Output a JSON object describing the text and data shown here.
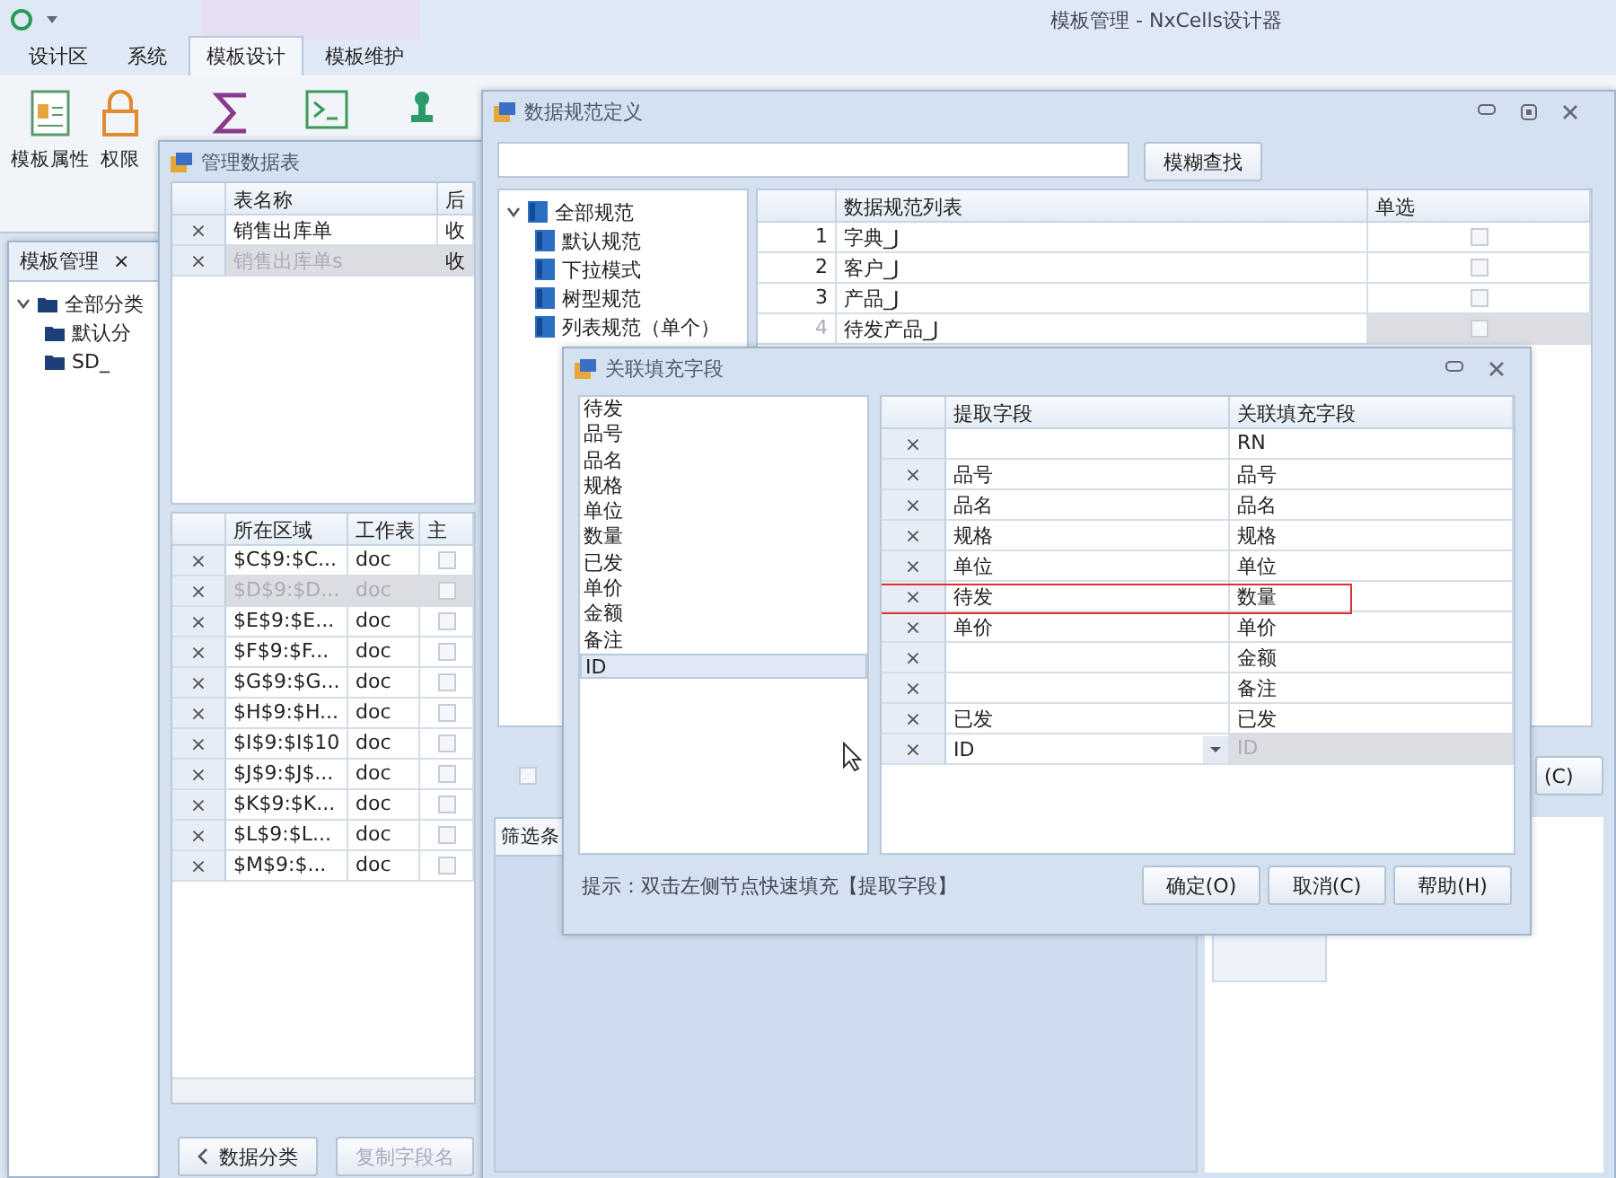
{
  "app": {
    "title": "模板管理 - NxCells设计器",
    "tabs": [
      {
        "label": "设计区",
        "selected": false
      },
      {
        "label": "系统",
        "selected": false
      },
      {
        "label": "模板设计",
        "selected": true
      },
      {
        "label": "模板维护",
        "selected": false
      }
    ],
    "ribbon": [
      "模板属性",
      "权限"
    ]
  },
  "side_panel": {
    "tab": "模板管理",
    "close": "×",
    "tree": [
      {
        "label": "全部分类",
        "expanded": true,
        "children": [
          {
            "label": "默认分"
          },
          {
            "label": "SD_"
          }
        ]
      }
    ]
  },
  "table_window": {
    "title": "管理数据表",
    "top_grid": {
      "columns": [
        "表名称",
        "后"
      ],
      "rows": [
        {
          "delete": "×",
          "cells": [
            "销售出库单",
            "收"
          ],
          "selected": false
        },
        {
          "delete": "×",
          "cells": [
            "销售出库单s",
            "收"
          ],
          "selected": true
        }
      ]
    },
    "bottom_grid": {
      "columns": [
        "所在区域",
        "工作表",
        "主"
      ],
      "rows": [
        {
          "delete": "×",
          "cells": [
            "$C$9:$C...",
            "doc"
          ],
          "selected": false,
          "checked": false
        },
        {
          "delete": "×",
          "cells": [
            "$D$9:$D...",
            "doc"
          ],
          "selected": true,
          "checked": false
        },
        {
          "delete": "×",
          "cells": [
            "$E$9:$E...",
            "doc"
          ],
          "selected": false,
          "checked": false
        },
        {
          "delete": "×",
          "cells": [
            "$F$9:$F...",
            "doc"
          ],
          "selected": false,
          "checked": false
        },
        {
          "delete": "×",
          "cells": [
            "$G$9:$G...",
            "doc"
          ],
          "selected": false,
          "checked": false
        },
        {
          "delete": "×",
          "cells": [
            "$H$9:$H...",
            "doc"
          ],
          "selected": false,
          "checked": false
        },
        {
          "delete": "×",
          "cells": [
            "$I$9:$I$10",
            "doc"
          ],
          "selected": false,
          "checked": false
        },
        {
          "delete": "×",
          "cells": [
            "$J$9:$J$...",
            "doc"
          ],
          "selected": false,
          "checked": false
        },
        {
          "delete": "×",
          "cells": [
            "$K$9:$K...",
            "doc"
          ],
          "selected": false,
          "checked": false
        },
        {
          "delete": "×",
          "cells": [
            "$L$9:$L...",
            "doc"
          ],
          "selected": false,
          "checked": false
        },
        {
          "delete": "×",
          "cells": [
            "$M$9:$...",
            "doc"
          ],
          "selected": false,
          "checked": false
        }
      ]
    },
    "buttons": [
      {
        "label": "数据分类",
        "disabled": false
      },
      {
        "label": "复制字段名",
        "disabled": true
      }
    ]
  },
  "spec_window": {
    "title": "数据规范定义",
    "search_button": "模糊查找",
    "tree": [
      {
        "label": "全部规范",
        "expanded": true,
        "children": [
          {
            "label": "默认规范"
          },
          {
            "label": "下拉模式"
          },
          {
            "label": "树型规范"
          },
          {
            "label": "列表规范（单个）"
          }
        ]
      }
    ],
    "grid": {
      "columns": [
        "数据规范列表",
        "单选"
      ],
      "rows": [
        {
          "index": "1",
          "name": "字典_J",
          "checked": false,
          "selected": false
        },
        {
          "index": "2",
          "name": "客户_J",
          "checked": false,
          "selected": false
        },
        {
          "index": "3",
          "name": "产品_J",
          "checked": false,
          "selected": false
        },
        {
          "index": "4",
          "name": "待发产品_J",
          "checked": false,
          "selected": true
        }
      ]
    },
    "option_checked": false,
    "side_button": "(C)",
    "filter_tab": "筛选条"
  },
  "dialog": {
    "title": "关联填充字段",
    "fields": [
      {
        "label": "待发",
        "selected": false
      },
      {
        "label": "品号",
        "selected": false
      },
      {
        "label": "品名",
        "selected": false
      },
      {
        "label": "规格",
        "selected": false
      },
      {
        "label": "单位",
        "selected": false
      },
      {
        "label": "数量",
        "selected": false
      },
      {
        "label": "已发",
        "selected": false
      },
      {
        "label": "单价",
        "selected": false
      },
      {
        "label": "金额",
        "selected": false
      },
      {
        "label": "备注",
        "selected": false
      },
      {
        "label": "ID",
        "selected": true
      }
    ],
    "grid": {
      "columns": [
        "提取字段",
        "关联填充字段"
      ],
      "rows": [
        {
          "delete": "×",
          "source": "",
          "target": "RN",
          "selected": false,
          "highlighted": false
        },
        {
          "delete": "×",
          "source": "品号",
          "target": "品号",
          "selected": false,
          "highlighted": false
        },
        {
          "delete": "×",
          "source": "品名",
          "target": "品名",
          "selected": false,
          "highlighted": false
        },
        {
          "delete": "×",
          "source": "规格",
          "target": "规格",
          "selected": false,
          "highlighted": false
        },
        {
          "delete": "×",
          "source": "单位",
          "target": "单位",
          "selected": false,
          "highlighted": false
        },
        {
          "delete": "×",
          "source": "待发",
          "target": "数量",
          "selected": false,
          "highlighted": true
        },
        {
          "delete": "×",
          "source": "单价",
          "target": "单价",
          "selected": false,
          "highlighted": false
        },
        {
          "delete": "×",
          "source": "",
          "target": "金额",
          "selected": false,
          "highlighted": false
        },
        {
          "delete": "×",
          "source": "",
          "target": "备注",
          "selected": false,
          "highlighted": false
        },
        {
          "delete": "×",
          "source": "已发",
          "target": "已发",
          "selected": false,
          "highlighted": false
        },
        {
          "delete": "×",
          "source": "ID",
          "target": "ID",
          "selected": true,
          "highlighted": false
        }
      ]
    },
    "hint": "提示：双击左侧节点快速填充【提取字段】",
    "buttons": [
      "确定(O)",
      "取消(C)",
      "帮助(H)"
    ]
  }
}
